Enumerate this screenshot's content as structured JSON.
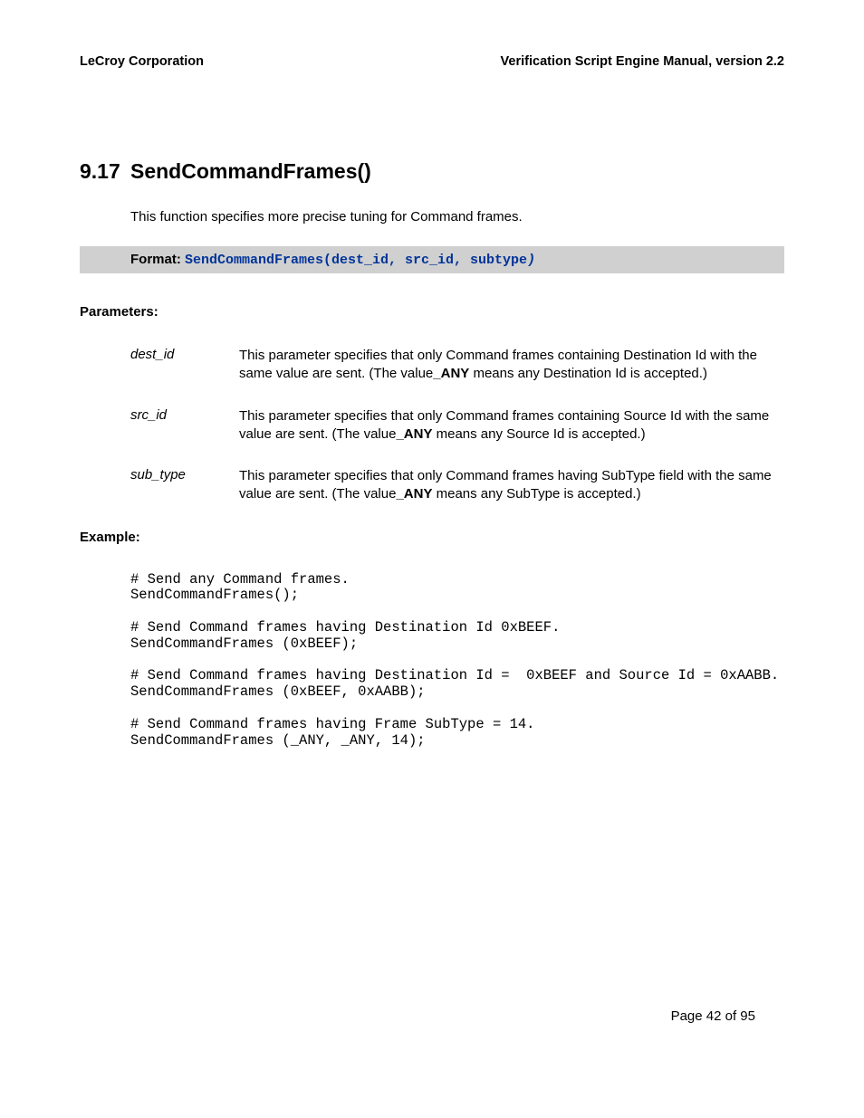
{
  "header": {
    "left": "LeCroy Corporation",
    "right": "Verification Script Engine Manual, version 2.2"
  },
  "section": {
    "num": "9.17",
    "title": "SendCommandFrames()"
  },
  "intro": "This function specifies more precise tuning for Command frames.",
  "format": {
    "label": "Format: ",
    "code": "SendCommandFrames(dest_id, src_id, subtype",
    "code_tail": ")"
  },
  "labels": {
    "parameters": "Parameters:",
    "example": "Example:"
  },
  "params": [
    {
      "name": "dest_id",
      "desc_pre": "This parameter specifies that only Command frames containing Destination Id with the same value are sent. (The value",
      "any": "_ANY",
      "desc_post": " means any Destination Id is accepted.)"
    },
    {
      "name": "src_id",
      "desc_pre": "This parameter specifies that only Command frames containing Source Id with the same value are sent. (The value",
      "any": "_ANY",
      "desc_post": " means any Source Id is accepted.)"
    },
    {
      "name": "sub_type",
      "desc_pre": "This parameter specifies that only Command frames having SubType field with the same value are sent. (The value",
      "any": "_ANY",
      "desc_post": " means any SubType is accepted.)"
    }
  ],
  "code": "# Send any Command frames.\nSendCommandFrames();\n\n# Send Command frames having Destination Id 0xBEEF.\nSendCommandFrames (0xBEEF);\n\n# Send Command frames having Destination Id =  0xBEEF and Source Id = 0xAABB.\nSendCommandFrames (0xBEEF, 0xAABB);\n\n# Send Command frames having Frame SubType = 14.\nSendCommandFrames (_ANY, _ANY, 14);",
  "footer": "Page 42 of 95"
}
